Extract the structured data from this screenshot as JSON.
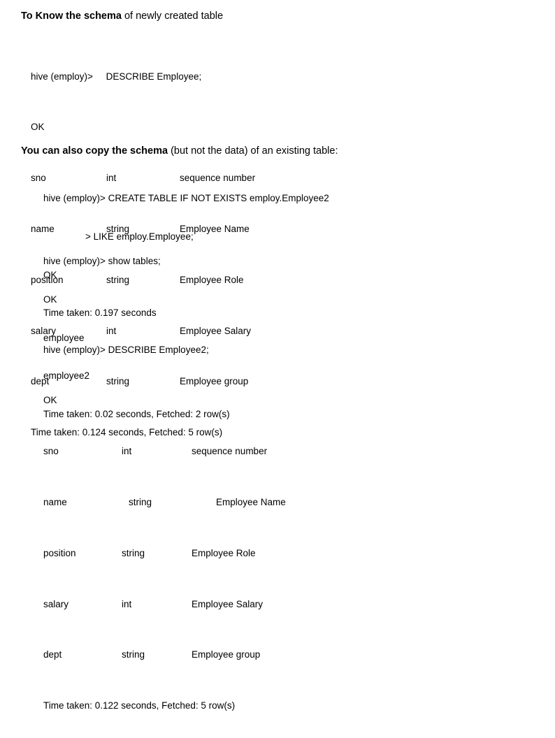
{
  "document": {
    "section_1": {
      "heading": {
        "bold_text": "To Know the schema",
        "rest_text": " of newly created table"
      },
      "console": {
        "prompt_line": "hive (employ)>     DESCRIBE Employee;",
        "status_ok": "OK",
        "schema_rows": [
          {
            "name": "sno",
            "type": "int",
            "comment": "sequence number"
          },
          {
            "name": "name",
            "type": "string",
            "comment": "Employee Name"
          },
          {
            "name": "position",
            "type": "string",
            "comment": "Employee Role"
          },
          {
            "name": "salary",
            "type": "int",
            "comment": "Employee Salary"
          },
          {
            "name": "dept",
            "type": "string",
            "comment": "Employee group"
          }
        ],
        "time_taken": "Time taken: 0.124 seconds, Fetched: 5 row(s)"
      }
    },
    "section_2": {
      "heading": {
        "bold_text": "You can also copy the schema",
        "rest_text": " (but not the data) of an existing table:"
      },
      "console_create": {
        "prompt_line": "hive (employ)> CREATE TABLE IF NOT EXISTS employ.Employee2",
        "continuation_line": "> LIKE employ.Employee;",
        "status_ok": "OK",
        "time_taken": "Time taken: 0.197 seconds"
      },
      "console_show_tables": {
        "prompt_line": "hive (employ)> show tables;",
        "status_ok": "OK",
        "tables": [
          "employee",
          "employee2"
        ],
        "time_taken": "Time taken: 0.02 seconds, Fetched: 2 row(s)"
      },
      "console_describe2": {
        "prompt_line": "hive (employ)> DESCRIBE Employee2;",
        "status_ok": "OK",
        "schema_rows": [
          {
            "name": "sno",
            "type": "int",
            "comment": "sequence number"
          },
          {
            "name": "name",
            "type": "string",
            "comment": "Employee Name"
          },
          {
            "name": "position",
            "type": "string",
            "comment": "Employee Role"
          },
          {
            "name": "salary",
            "type": "int",
            "comment": "Employee Salary"
          },
          {
            "name": "dept",
            "type": "string",
            "comment": "Employee group"
          }
        ],
        "time_taken": "Time taken: 0.122 seconds, Fetched: 5 row(s)"
      }
    }
  }
}
